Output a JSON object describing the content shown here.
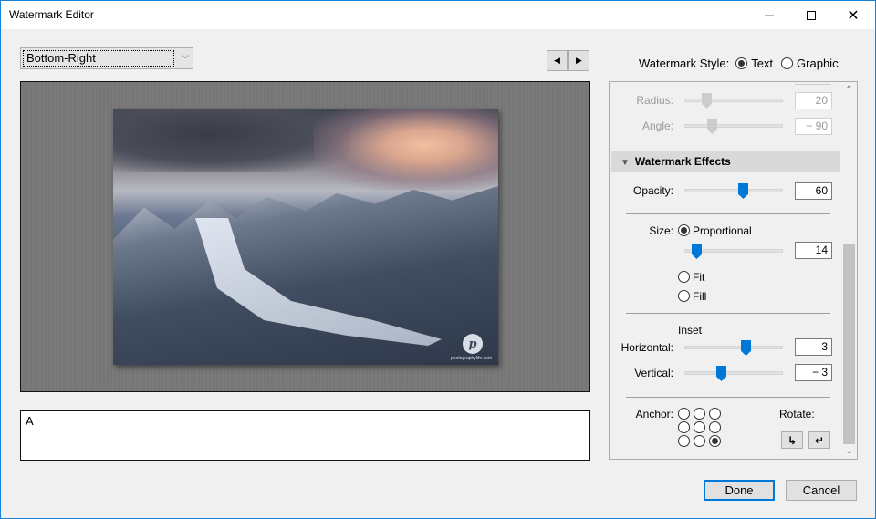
{
  "window": {
    "title": "Watermark Editor",
    "controls": {
      "minimize": "minimize-icon",
      "maximize": "maximize-icon",
      "close": "close-icon"
    }
  },
  "toolbar": {
    "position_select": {
      "value": "Bottom-Right"
    },
    "prev_icon": "◀",
    "next_icon": "▶"
  },
  "preview": {
    "watermark_logo_glyph": "p",
    "watermark_caption": "photographylife.com"
  },
  "text_input": {
    "value": "A"
  },
  "watermark_style": {
    "label": "Watermark Style:",
    "options": [
      {
        "label": "Text",
        "selected": true
      },
      {
        "label": "Graphic",
        "selected": false
      }
    ]
  },
  "panel": {
    "shadow": {
      "radius": {
        "label": "Radius:",
        "value": "20",
        "fraction": 0.22,
        "enabled": false
      },
      "angle": {
        "label": "Angle:",
        "value": "− 90",
        "fraction": 0.25,
        "enabled": false
      }
    },
    "effects": {
      "title": "Watermark Effects",
      "opacity": {
        "label": "Opacity:",
        "value": "60",
        "fraction": 0.6
      },
      "size": {
        "label": "Size:",
        "options": [
          {
            "label": "Proportional",
            "selected": true
          },
          {
            "label": "Fit",
            "selected": false
          },
          {
            "label": "Fill",
            "selected": false
          }
        ],
        "value": "14",
        "fraction": 0.13
      },
      "inset": {
        "title": "Inset",
        "horizontal": {
          "label": "Horizontal:",
          "value": "3",
          "fraction": 0.63
        },
        "vertical": {
          "label": "Vertical:",
          "value": "− 3",
          "fraction": 0.38
        }
      },
      "anchor": {
        "label": "Anchor:",
        "selected": "bottom-right",
        "positions": [
          "top-left",
          "top-center",
          "top-right",
          "middle-left",
          "center",
          "middle-right",
          "bottom-left",
          "bottom-center",
          "bottom-right"
        ]
      },
      "rotate": {
        "label": "Rotate:",
        "cw_icon": "↳",
        "ccw_icon": "↵"
      }
    }
  },
  "buttons": {
    "done": "Done",
    "cancel": "Cancel"
  },
  "colors": {
    "accent": "#0078d7",
    "title_border": "#1883d7"
  }
}
